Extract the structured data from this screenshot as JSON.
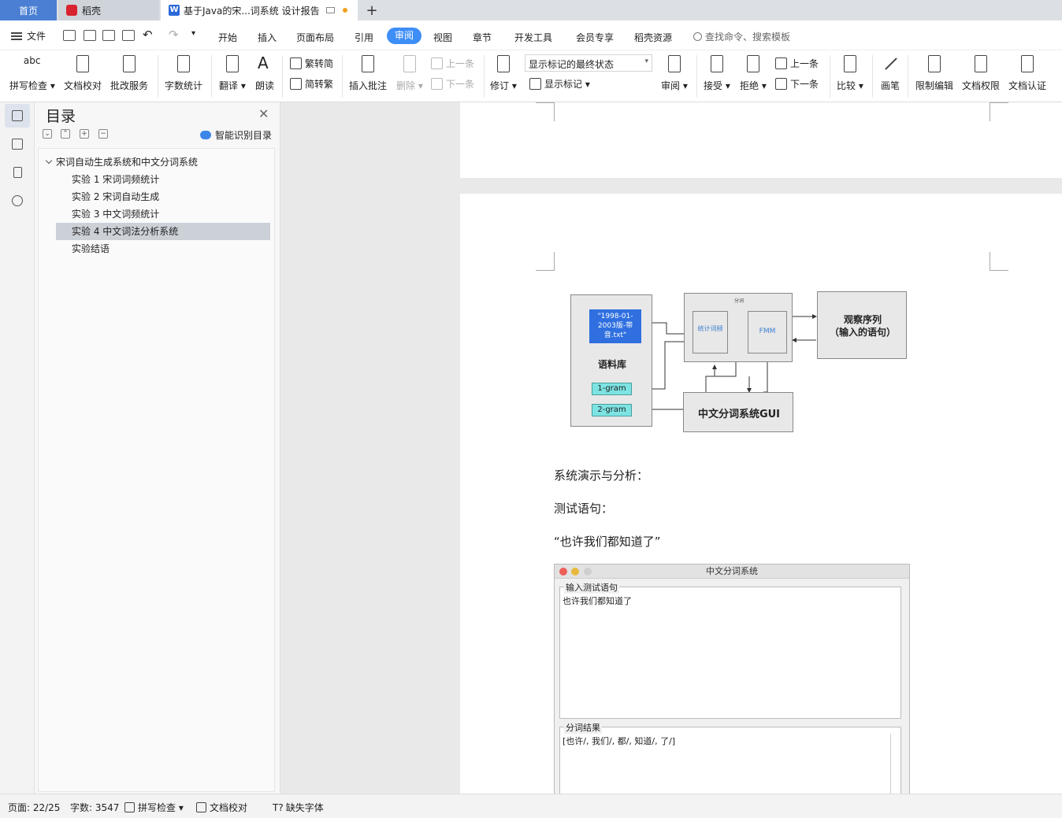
{
  "tabs": {
    "home": "首页",
    "daoke": "稻壳",
    "doc_title": "基于Java的宋...词系统 设计报告",
    "add": "+"
  },
  "menu": {
    "file": "文件",
    "items": [
      "开始",
      "插入",
      "页面布局",
      "引用",
      "审阅",
      "视图",
      "章节",
      "开发工具",
      "会员专享",
      "稻壳资源"
    ],
    "active": "审阅",
    "search_placeholder": "查找命令、搜索模板"
  },
  "ribbon": {
    "spell": "拼写检查",
    "proofread": "文档校对",
    "review_service": "批改服务",
    "word_count": "字数统计",
    "translate": "翻译",
    "read_aloud": "朗读",
    "t2s": "繁转简",
    "s2t": "简转繁",
    "insert_comment": "插入批注",
    "delete": "删除",
    "prev_comment": "上一条",
    "next_comment": "下一条",
    "track_changes": "修订",
    "markup_state": "显示标记的最终状态",
    "show_markup": "显示标记",
    "review_pane": "审阅",
    "accept": "接受",
    "reject": "拒绝",
    "prev_change": "上一条",
    "next_change": "下一条",
    "compare": "比较",
    "pen": "画笔",
    "restrict_edit": "限制编辑",
    "doc_permission": "文档权限",
    "doc_certify": "文档认证"
  },
  "toc": {
    "title": "目录",
    "smart_recognize": "智能识别目录",
    "root": "宋词自动生成系统和中文分词系统",
    "items": [
      "实验 1  宋词词频统计",
      "实验 2  宋词自动生成",
      "实验 3  中文词频统计",
      "实验 4  中文词法分析系统",
      "实验结语"
    ],
    "selected_index": 3
  },
  "diagram": {
    "corpus_file": "\"1998-01-2003版-带音.txt\"",
    "corpus_label": "语料库",
    "gram1": "1-gram",
    "gram2": "2-gram",
    "segment_label": "分词",
    "stat_freq": "统计词频",
    "fmm": "FMM",
    "observe_line1": "观察序列",
    "observe_line2": "（输入的语句）",
    "gui": "中文分词系统GUI"
  },
  "document": {
    "para1": "系统演示与分析：",
    "para2": "测试语句：",
    "para3": "“也许我们都知道了”"
  },
  "gui_window": {
    "title": "中文分词系统",
    "input_label": "输入测试语句",
    "input_text": "也许我们都知道了",
    "result_label": "分词结果",
    "result_text": "[也许/, 我们/, 都/, 知道/, 了/]"
  },
  "status": {
    "page": "页面: 22/25",
    "words": "字数: 3547",
    "spell": "拼写检查",
    "proofread": "文档校对",
    "missing_font": "缺失字体"
  },
  "colors": {
    "accent": "#3e8ef7",
    "home_tab": "#4a7fd3",
    "corpus_blue": "#2f6fe0",
    "gram_cyan": "#7de3e3"
  }
}
